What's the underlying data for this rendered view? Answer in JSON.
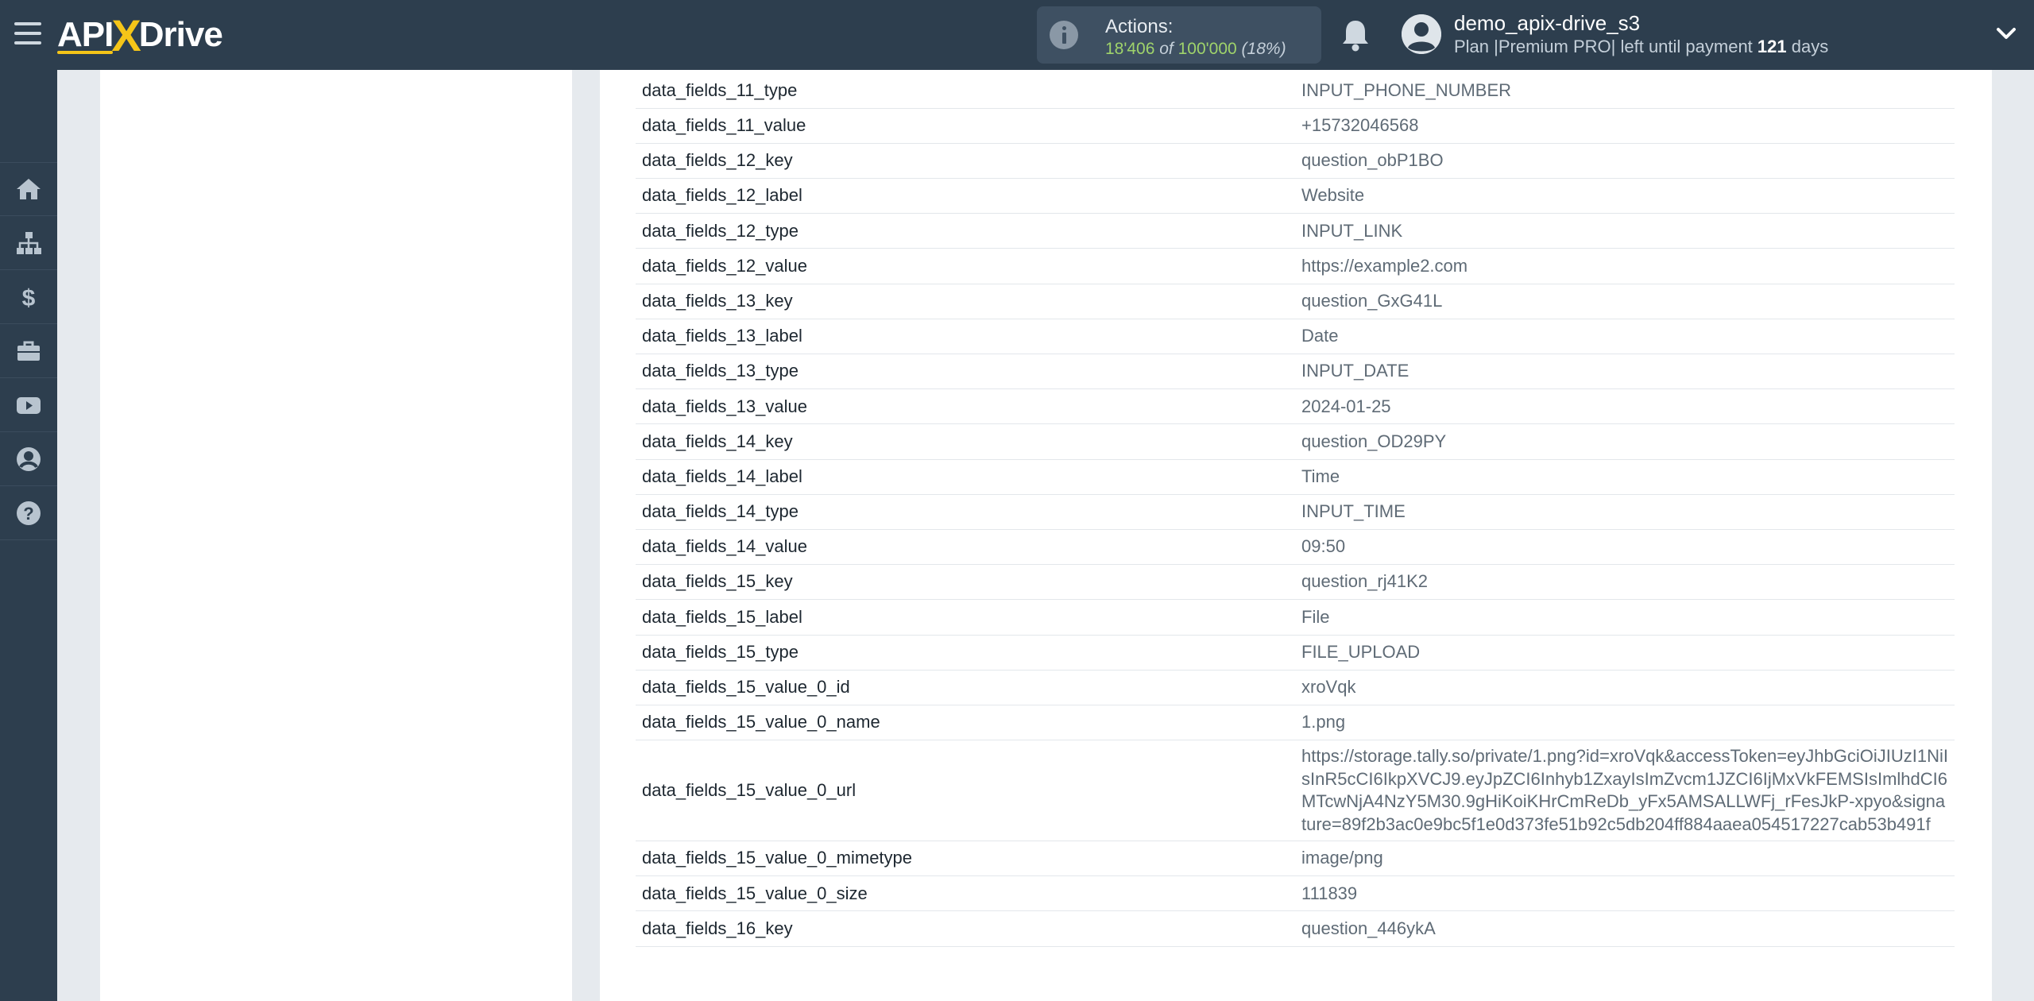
{
  "header": {
    "logo_api": "API",
    "logo_x": "X",
    "logo_drive": "Drive",
    "actions_title": "Actions:",
    "actions_used": "18'406",
    "actions_of": "of",
    "actions_limit": "100'000",
    "actions_percent": "(18%)",
    "user_name": "demo_apix-drive_s3",
    "plan_prefix": "Plan |Premium PRO| left until payment",
    "plan_days": "121",
    "plan_suffix": "days"
  },
  "sidebar": {
    "items": [
      {
        "icon": "home-icon"
      },
      {
        "icon": "sitemap-icon"
      },
      {
        "icon": "dollar-icon"
      },
      {
        "icon": "briefcase-icon"
      },
      {
        "icon": "youtube-icon"
      },
      {
        "icon": "user-icon"
      },
      {
        "icon": "help-icon"
      }
    ]
  },
  "table": {
    "rows": [
      {
        "key": "data_fields_11_type",
        "value": "INPUT_PHONE_NUMBER"
      },
      {
        "key": "data_fields_11_value",
        "value": "+15732046568"
      },
      {
        "key": "data_fields_12_key",
        "value": "question_obP1BO"
      },
      {
        "key": "data_fields_12_label",
        "value": "Website"
      },
      {
        "key": "data_fields_12_type",
        "value": "INPUT_LINK"
      },
      {
        "key": "data_fields_12_value",
        "value": "https://example2.com"
      },
      {
        "key": "data_fields_13_key",
        "value": "question_GxG41L"
      },
      {
        "key": "data_fields_13_label",
        "value": "Date"
      },
      {
        "key": "data_fields_13_type",
        "value": "INPUT_DATE"
      },
      {
        "key": "data_fields_13_value",
        "value": "2024-01-25"
      },
      {
        "key": "data_fields_14_key",
        "value": "question_OD29PY"
      },
      {
        "key": "data_fields_14_label",
        "value": "Time"
      },
      {
        "key": "data_fields_14_type",
        "value": "INPUT_TIME"
      },
      {
        "key": "data_fields_14_value",
        "value": "09:50"
      },
      {
        "key": "data_fields_15_key",
        "value": "question_rj41K2"
      },
      {
        "key": "data_fields_15_label",
        "value": "File"
      },
      {
        "key": "data_fields_15_type",
        "value": "FILE_UPLOAD"
      },
      {
        "key": "data_fields_15_value_0_id",
        "value": "xroVqk"
      },
      {
        "key": "data_fields_15_value_0_name",
        "value": "1.png"
      },
      {
        "key": "data_fields_15_value_0_url",
        "value": "https://storage.tally.so/private/1.png?id=xroVqk&accessToken=eyJhbGciOiJIUzI1NiIsInR5cCI6IkpXVCJ9.eyJpZCI6Inhyb1ZxayIsImZvcm1JZCI6IjMxVkFEMSIsImlhdCI6MTcwNjA4NzY5M30.9gHiKoiKHrCmReDb_yFx5AMSALLWFj_rFesJkP-xpyo&signature=89f2b3ac0e9bc5f1e0d373fe51b92c5db204ff884aaea054517227cab53b491f"
      },
      {
        "key": "data_fields_15_value_0_mimetype",
        "value": "image/png"
      },
      {
        "key": "data_fields_15_value_0_size",
        "value": "111839"
      },
      {
        "key": "data_fields_16_key",
        "value": "question_446ykA"
      }
    ]
  }
}
